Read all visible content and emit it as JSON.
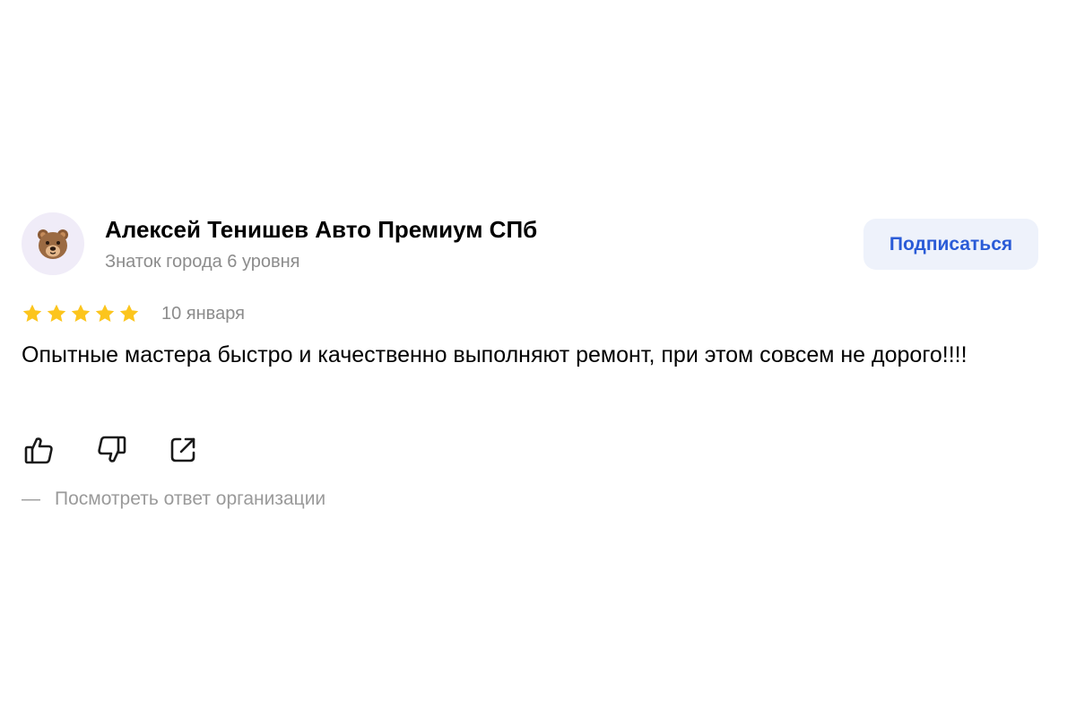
{
  "author": {
    "name": "Алексей Тенишев Авто Премиум СПб",
    "level": "Знаток города 6 уровня",
    "avatar_icon": "bear-face-icon",
    "avatar_emoji": "🐻"
  },
  "subscribe": {
    "label": "Подписаться"
  },
  "review": {
    "rating": 5,
    "rating_max": 5,
    "date": "10 января",
    "text": "Опытные мастера быстро и качественно выполняют ремонт, при этом совсем не дорого!!!!"
  },
  "actions": {
    "icons": [
      "thumbs-up-icon",
      "thumbs-down-icon",
      "share-icon"
    ]
  },
  "org_reply": {
    "dash": "—",
    "label": "Посмотреть ответ организации"
  },
  "colors": {
    "star": "#fcc51d",
    "accent": "#2a5bd7",
    "button_bg": "#eef2fb",
    "muted_text": "#8c8c8c"
  }
}
